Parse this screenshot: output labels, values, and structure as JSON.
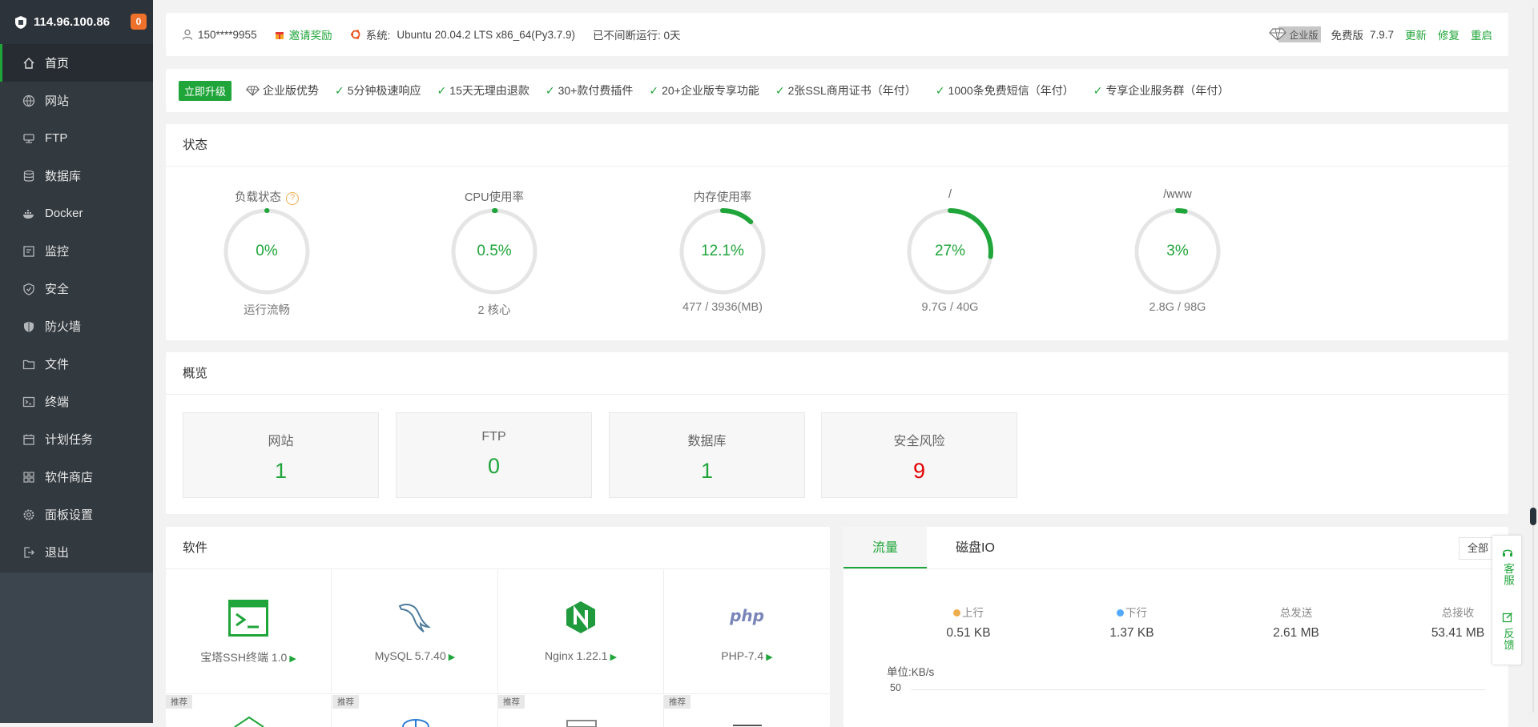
{
  "sidebar": {
    "ip": "114.96.100.86",
    "badge": "0",
    "items": [
      {
        "label": "首页",
        "icon": "home-icon"
      },
      {
        "label": "网站",
        "icon": "globe-icon"
      },
      {
        "label": "FTP",
        "icon": "ftp-icon"
      },
      {
        "label": "数据库",
        "icon": "database-icon"
      },
      {
        "label": "Docker",
        "icon": "docker-icon"
      },
      {
        "label": "监控",
        "icon": "monitor-icon"
      },
      {
        "label": "安全",
        "icon": "shield-icon"
      },
      {
        "label": "防火墙",
        "icon": "firewall-icon"
      },
      {
        "label": "文件",
        "icon": "folder-icon"
      },
      {
        "label": "终端",
        "icon": "terminal-icon"
      },
      {
        "label": "计划任务",
        "icon": "calendar-icon"
      },
      {
        "label": "软件商店",
        "icon": "grid-icon"
      },
      {
        "label": "面板设置",
        "icon": "gear-icon"
      },
      {
        "label": "退出",
        "icon": "logout-icon"
      }
    ]
  },
  "topbar": {
    "user": "150****9955",
    "invite": "邀请奖励",
    "system_label": "系统:",
    "system_value": "Ubuntu 20.04.2 LTS x86_64(Py3.7.9)",
    "uptime": "已不间断运行: 0天",
    "enterprise": "企业版",
    "free_version": "免费版",
    "version": "7.9.7",
    "update": "更新",
    "repair": "修复",
    "restart": "重启"
  },
  "upgrade": {
    "button": "立即升级",
    "advantage": "企业版优势",
    "features": [
      "5分钟极速响应",
      "15天无理由退款",
      "30+款付费插件",
      "20+企业版专享功能",
      "2张SSL商用证书（年付）",
      "1000条免费短信（年付）",
      "专享企业服务群（年付）"
    ]
  },
  "status": {
    "title": "状态",
    "gauges": [
      {
        "label": "负载状态",
        "value": "0%",
        "sub": "运行流畅",
        "fraction": 0.0
      },
      {
        "label": "CPU使用率",
        "value": "0.5%",
        "sub": "2 核心",
        "fraction": 0.005
      },
      {
        "label": "内存使用率",
        "value": "12.1%",
        "sub": "477 / 3936(MB)",
        "fraction": 0.121
      },
      {
        "label": "/",
        "value": "27%",
        "sub": "9.7G / 40G",
        "fraction": 0.27
      },
      {
        "label": "/www",
        "value": "3%",
        "sub": "2.8G / 98G",
        "fraction": 0.03
      }
    ]
  },
  "overview": {
    "title": "概览",
    "boxes": [
      {
        "label": "网站",
        "value": "1",
        "color": "#20a53a"
      },
      {
        "label": "FTP",
        "value": "0",
        "color": "#20a53a"
      },
      {
        "label": "数据库",
        "value": "1",
        "color": "#20a53a"
      },
      {
        "label": "安全风险",
        "value": "9",
        "color": "#e20000"
      }
    ]
  },
  "software": {
    "title": "软件",
    "items": [
      {
        "name": "宝塔SSH终端 1.0",
        "icon": "terminal-icon"
      },
      {
        "name": "MySQL 5.7.40",
        "icon": "mysql-icon"
      },
      {
        "name": "Nginx 1.22.1",
        "icon": "nginx-icon"
      },
      {
        "name": "PHP-7.4",
        "icon": "php-icon"
      }
    ],
    "recommend_tag": "推荐"
  },
  "traffic": {
    "tabs": [
      "流量",
      "磁盘IO"
    ],
    "select": "全部",
    "stats": [
      {
        "label": "上行",
        "value": "0.51 KB",
        "dot": "#f0ad4e"
      },
      {
        "label": "下行",
        "value": "1.37 KB",
        "dot": "#52a9ff"
      },
      {
        "label": "总发送",
        "value": "2.61 MB"
      },
      {
        "label": "总接收",
        "value": "53.41 MB"
      }
    ],
    "unit": "单位:KB/s",
    "y_tick": "50"
  },
  "float": {
    "service": "客服",
    "feedback": "反馈"
  },
  "colors": {
    "accent": "#20a53a",
    "sidebar": "#3c444d",
    "danger": "#e20000"
  }
}
